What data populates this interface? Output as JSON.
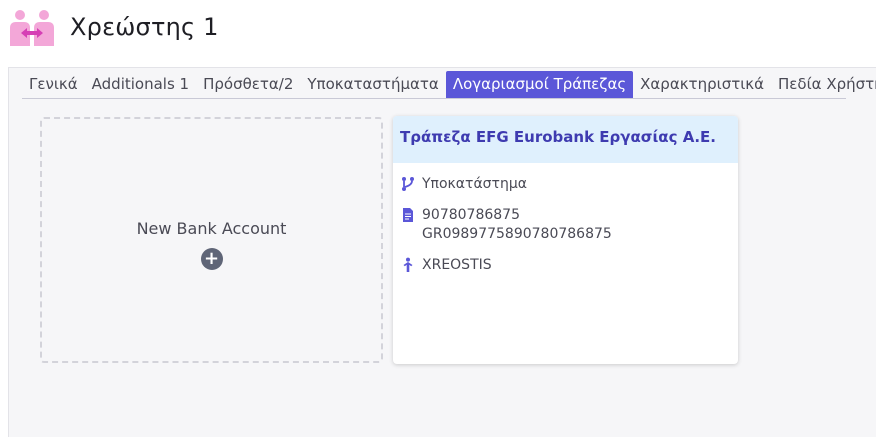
{
  "header": {
    "title": "Χρεώστης 1",
    "logo_icon": "debtor-exchange-icon"
  },
  "tabs": [
    {
      "label": "Γενικά",
      "active": false
    },
    {
      "label": "Additionals 1",
      "active": false
    },
    {
      "label": "Πρόσθετα/2",
      "active": false
    },
    {
      "label": "Υποκαταστήματα",
      "active": false
    },
    {
      "label": "Λογαριασμοί Τράπεζας",
      "active": true
    },
    {
      "label": "Χαρακτηριστικά",
      "active": false
    },
    {
      "label": "Πεδία Χρήστη",
      "active": false
    }
  ],
  "new_account": {
    "label": "New Bank Account",
    "icon": "plus-circle-icon"
  },
  "bank_card": {
    "bank_name": "Τράπεζα EFG Eurobank Εργασίας Α.Ε.",
    "branch_label": "Υποκατάστημα",
    "account_number": "90780786875",
    "iban": "GR0989775890780786875",
    "holder": "XREOSTIS"
  },
  "colors": {
    "accent": "#5b57d8",
    "card_header_bg": "#dff0fd",
    "bank_name": "#3e3bb0",
    "icon": "#5b57d8",
    "logo_pink": "#f3a7d8",
    "logo_magenta": "#d63fb5"
  }
}
